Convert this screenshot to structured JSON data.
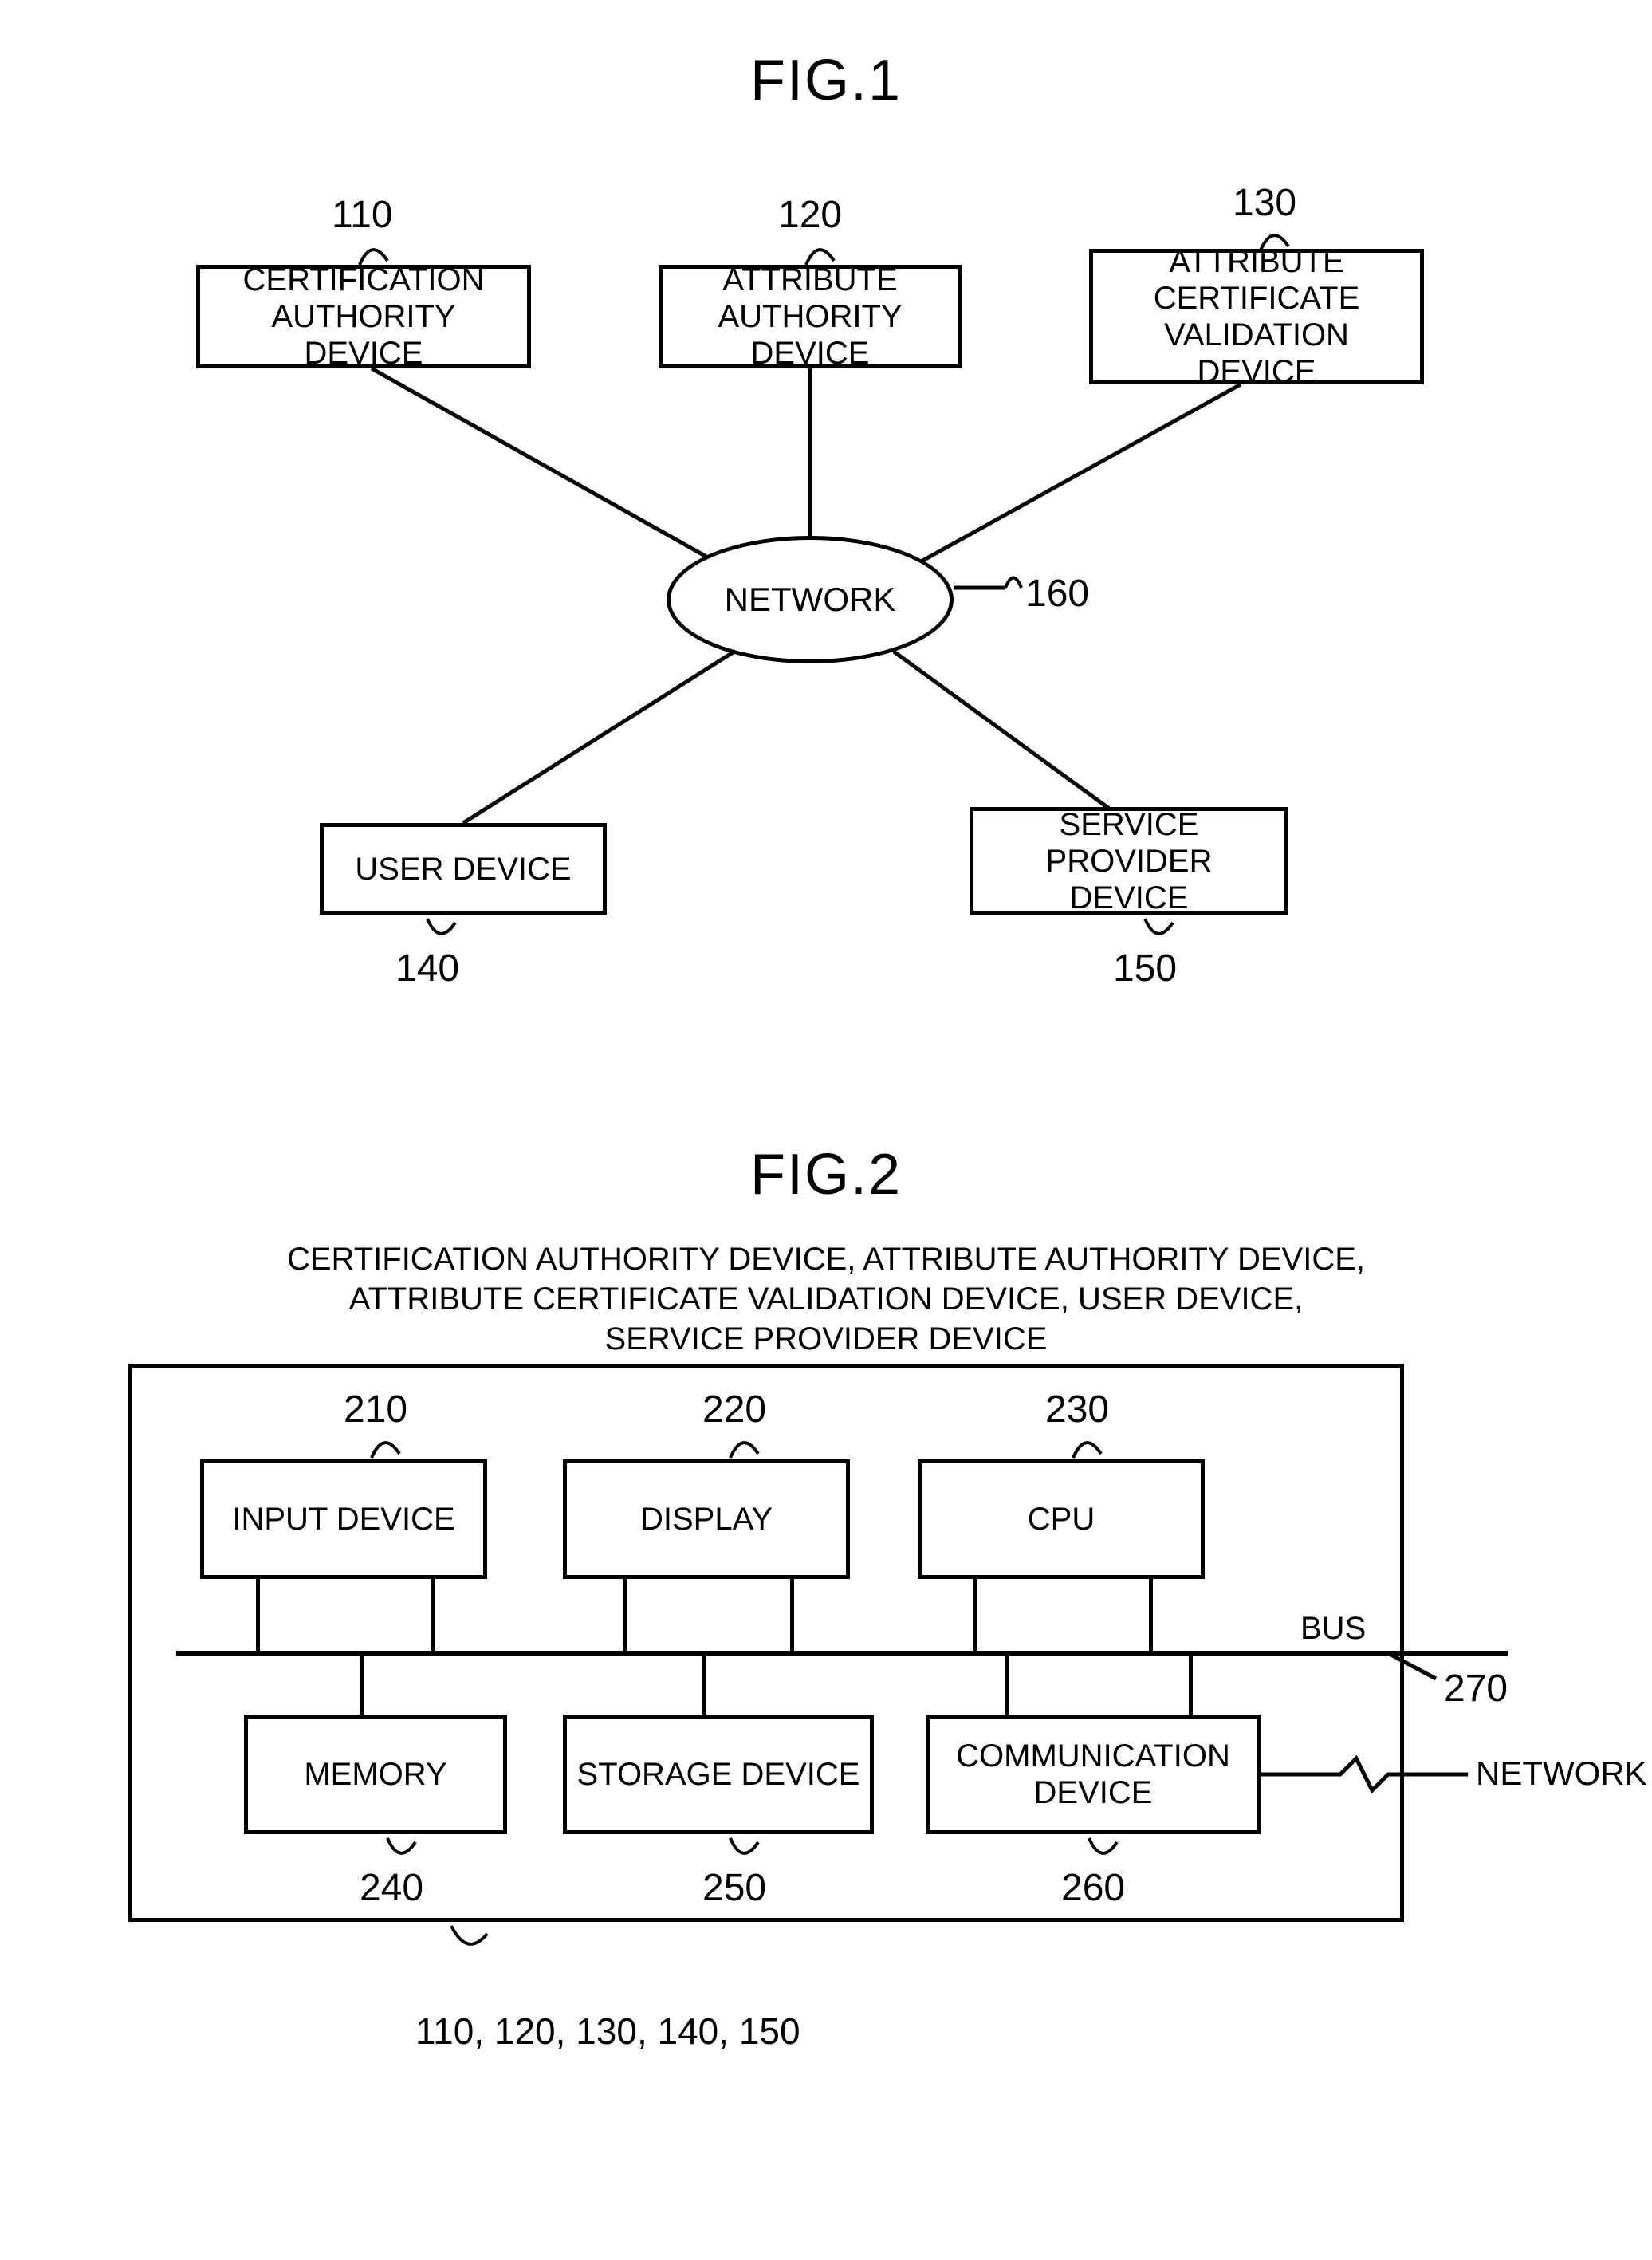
{
  "fig1": {
    "title": "FIG.1",
    "nodes": {
      "ca": {
        "label": "CERTIFICATION\nAUTHORITY DEVICE",
        "ref": "110"
      },
      "aa": {
        "label": "ATTRIBUTE\nAUTHORITY DEVICE",
        "ref": "120"
      },
      "acv": {
        "label": "ATTRIBUTE\nCERTIFICATE\nVALIDATION DEVICE",
        "ref": "130"
      },
      "user": {
        "label": "USER DEVICE",
        "ref": "140"
      },
      "sp": {
        "label": "SERVICE\nPROVIDER DEVICE",
        "ref": "150"
      },
      "net": {
        "label": "NETWORK",
        "ref": "160"
      }
    }
  },
  "fig2": {
    "title": "FIG.2",
    "caption": "CERTIFICATION AUTHORITY DEVICE, ATTRIBUTE AUTHORITY DEVICE,\nATTRIBUTE CERTIFICATE VALIDATION DEVICE, USER DEVICE,\nSERVICE PROVIDER DEVICE",
    "blocks": {
      "input": {
        "label": "INPUT DEVICE",
        "ref": "210"
      },
      "display": {
        "label": "DISPLAY",
        "ref": "220"
      },
      "cpu": {
        "label": "CPU",
        "ref": "230"
      },
      "memory": {
        "label": "MEMORY",
        "ref": "240"
      },
      "storage": {
        "label": "STORAGE DEVICE",
        "ref": "250"
      },
      "comm": {
        "label": "COMMUNICATION\nDEVICE",
        "ref": "260"
      }
    },
    "bus": {
      "label": "BUS",
      "ref": "270"
    },
    "network_label": "NETWORK",
    "frame_refs": "110, 120, 130, 140, 150"
  }
}
